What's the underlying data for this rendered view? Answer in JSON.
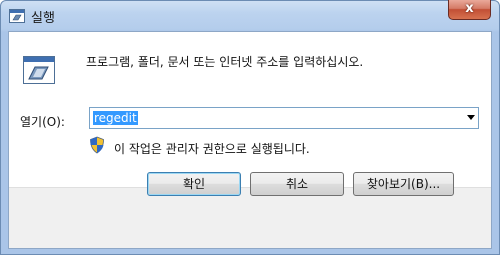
{
  "window": {
    "title": "실행",
    "close_glyph": "x"
  },
  "dialog": {
    "description": "프로그램, 폴더, 문서 또는 인터넷 주소를 입력하십시오.",
    "open_label": "열기(O):",
    "open_value": "regedit",
    "admin_note": "이 작업은 관리자 권한으로 실행됩니다."
  },
  "buttons": {
    "ok": "확인",
    "cancel": "취소",
    "browse": "찾아보기(B)..."
  },
  "icons": {
    "title": "run-icon",
    "main": "run-icon",
    "shield": "uac-shield-icon",
    "close": "close-icon",
    "dropdown": "chevron-down-icon"
  }
}
